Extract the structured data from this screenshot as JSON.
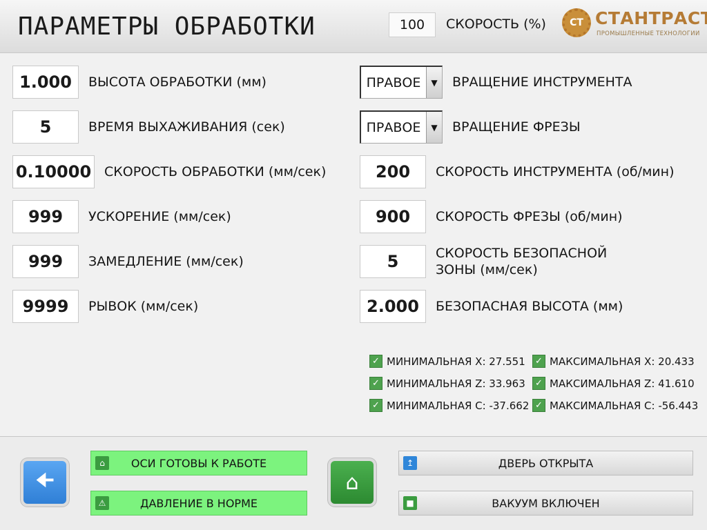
{
  "header": {
    "title": "ПАРАМЕТРЫ ОБРАБОТКИ",
    "speed_value": "100",
    "speed_label": "СКОРОСТЬ (%)",
    "logo_mark": "CT",
    "logo_name": "СТАНТРАСТ",
    "logo_sub": "ПРОМЫШЛЕННЫЕ ТЕХНОЛОГИИ"
  },
  "left_fields": [
    {
      "value": "1.000",
      "label": "ВЫСОТА ОБРАБОТКИ (мм)"
    },
    {
      "value": "5",
      "label": "ВРЕМЯ ВЫХАЖИВАНИЯ (сек)"
    },
    {
      "value": "0.10000",
      "label": "СКОРОСТЬ ОБРАБОТКИ (мм/сек)"
    },
    {
      "value": "999",
      "label": "УСКОРЕНИЕ (мм/сек)"
    },
    {
      "value": "999",
      "label": "ЗАМЕДЛЕНИЕ (мм/сек)"
    },
    {
      "value": "9999",
      "label": "РЫВОК (мм/сек)"
    }
  ],
  "right_dropdowns": [
    {
      "value": "ПРАВОЕ",
      "label": "ВРАЩЕНИЕ ИНСТРУМЕНТА"
    },
    {
      "value": "ПРАВОЕ",
      "label": "ВРАЩЕНИЕ ФРЕЗЫ"
    }
  ],
  "right_fields": [
    {
      "value": "200",
      "label": "СКОРОСТЬ ИНСТРУМЕНТА (об/мин)"
    },
    {
      "value": "900",
      "label": "СКОРОСТЬ ФРЕЗЫ (об/мин)"
    },
    {
      "value": "5",
      "label_line1": "СКОРОСТЬ БЕЗОПАСНОЙ",
      "label_line2": "ЗОНЫ (мм/сек)"
    },
    {
      "value": "2.000",
      "label": "БЕЗОПАСНАЯ ВЫСОТА (мм)"
    }
  ],
  "limits": [
    {
      "text": "МИНИМАЛЬНАЯ X: 27.551"
    },
    {
      "text": "МИНИМАЛЬНАЯ Z: 33.963"
    },
    {
      "text": "МИНИМАЛЬНАЯ C: -37.662"
    },
    {
      "text": "МАКСИМАЛЬНАЯ X: 20.433"
    },
    {
      "text": "МАКСИМАЛЬНАЯ Z: 41.610"
    },
    {
      "text": "МАКСИМАЛЬНАЯ C: -56.443"
    }
  ],
  "footer": {
    "axes_ready": "ОСИ ГОТОВЫ К РАБОТЕ",
    "pressure_ok": "ДАВЛЕНИЕ В НОРМЕ",
    "door_open": "ДВЕРЬ ОТКРЫТА",
    "vacuum_on": "ВАКУУМ ВКЛЮЧЕН"
  },
  "icons": {
    "back": "arrow-left-icon",
    "home": "home-icon",
    "check": "checkmark-icon",
    "warning": "warning-icon",
    "door": "door-icon",
    "vacuum": "square-icon"
  },
  "colors": {
    "status_green": "#7cf37e",
    "back_blue": "#2f7fd6",
    "home_green": "#2c8a31",
    "logo_brown": "#b57b35"
  }
}
